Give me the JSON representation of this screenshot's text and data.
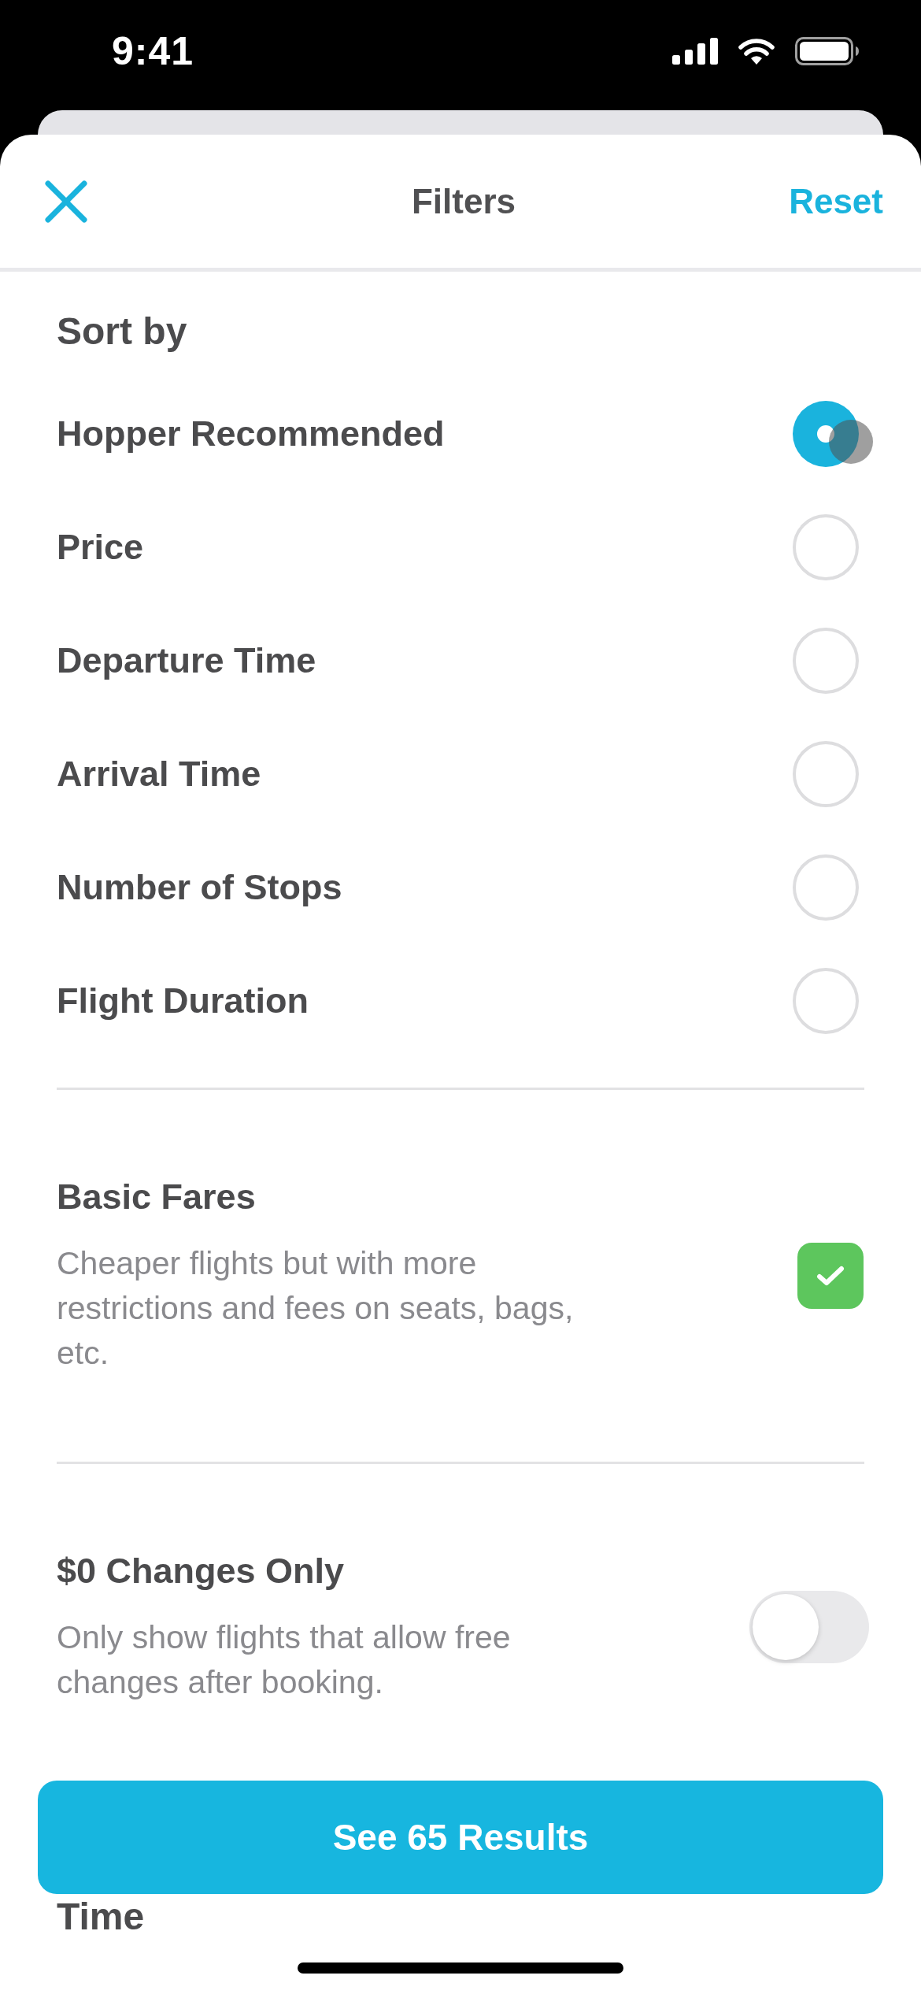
{
  "status_bar": {
    "time": "9:41"
  },
  "header": {
    "title": "Filters",
    "reset_label": "Reset"
  },
  "sort": {
    "title": "Sort by",
    "options": [
      {
        "label": "Hopper Recommended",
        "selected": true,
        "touched": true
      },
      {
        "label": "Price",
        "selected": false,
        "touched": false
      },
      {
        "label": "Departure Time",
        "selected": false,
        "touched": false
      },
      {
        "label": "Arrival Time",
        "selected": false,
        "touched": false
      },
      {
        "label": "Number of Stops",
        "selected": false,
        "touched": false
      },
      {
        "label": "Flight Duration",
        "selected": false,
        "touched": false
      }
    ]
  },
  "filters": [
    {
      "kind": "checkbox",
      "title": "Basic Fares",
      "description": "Cheaper flights but with more restrictions and fees on seats, bags, etc.",
      "checked": true
    },
    {
      "kind": "toggle",
      "title": "$0 Changes Only",
      "description": "Only show flights that allow free changes after booking.",
      "on": false
    }
  ],
  "next_section": {
    "title": "Time"
  },
  "results_button": {
    "label": "See 65 Results"
  }
}
